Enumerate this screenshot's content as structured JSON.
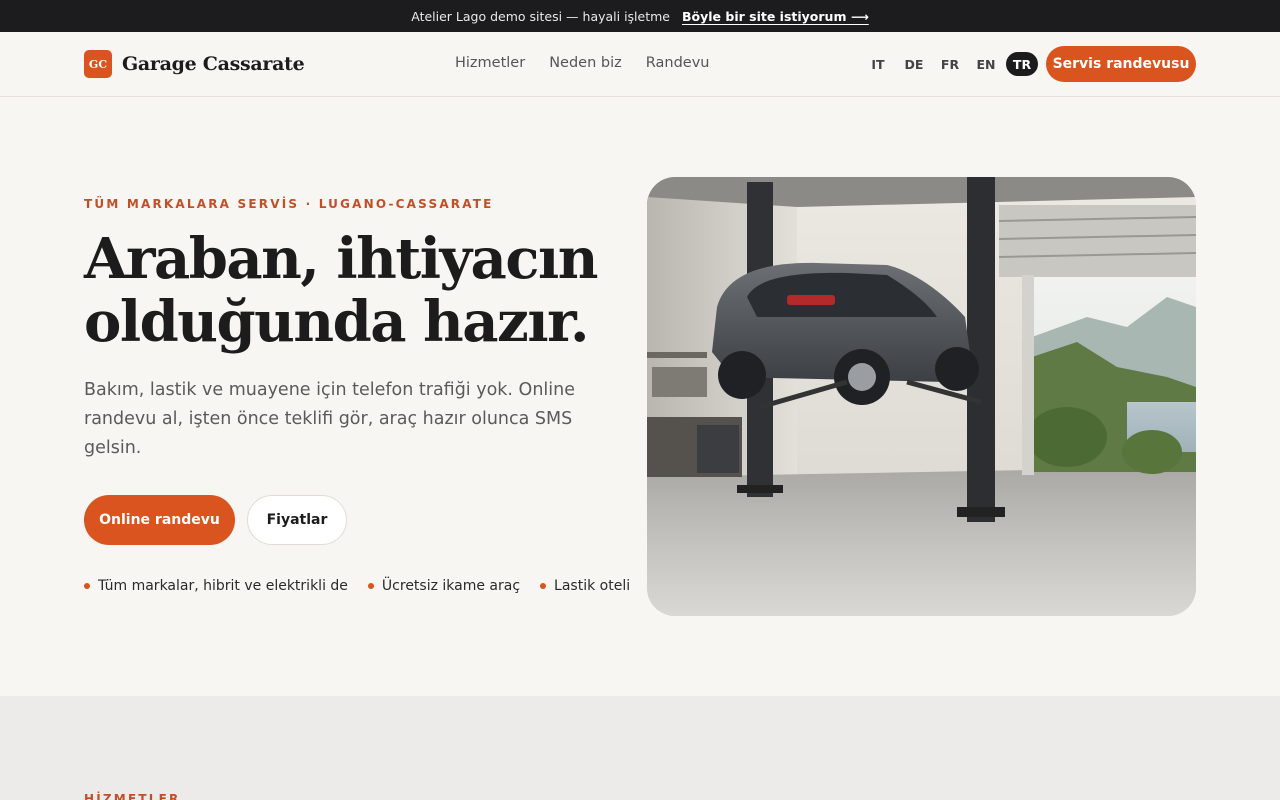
{
  "demo_bar": {
    "text": "Atelier Lago demo sitesi — hayali işletme",
    "cta": "Böyle bir site istiyorum ⟶"
  },
  "brand": {
    "mark": "GC",
    "name": "Garage Cassarate",
    "accent": "#d9541e"
  },
  "nav": {
    "items": [
      "Hizmetler",
      "Neden biz",
      "Randevu"
    ]
  },
  "languages": {
    "items": [
      "IT",
      "DE",
      "FR",
      "EN",
      "TR"
    ],
    "active": "TR"
  },
  "header_cta": "Servis randevusu",
  "hero": {
    "eyebrow": "TÜM MARKALARA SERVİS · LUGANO-CASSARATE",
    "headline": "Araban, ihtiyacın olduğunda hazır.",
    "lead": "Bakım, lastik ve muayene için telefon trafiği yok. Online randevu al, işten önce teklifi gör, araç hazır olunca SMS gelsin.",
    "primary_button": "Online randevu",
    "secondary_button": "Fiyatlar",
    "bullets": [
      "Tüm markalar, hibrit ve elektrikli de",
      "Ücretsiz ikame araç",
      "Lastik oteli"
    ]
  },
  "services": {
    "eyebrow": "HİZMETLER"
  }
}
